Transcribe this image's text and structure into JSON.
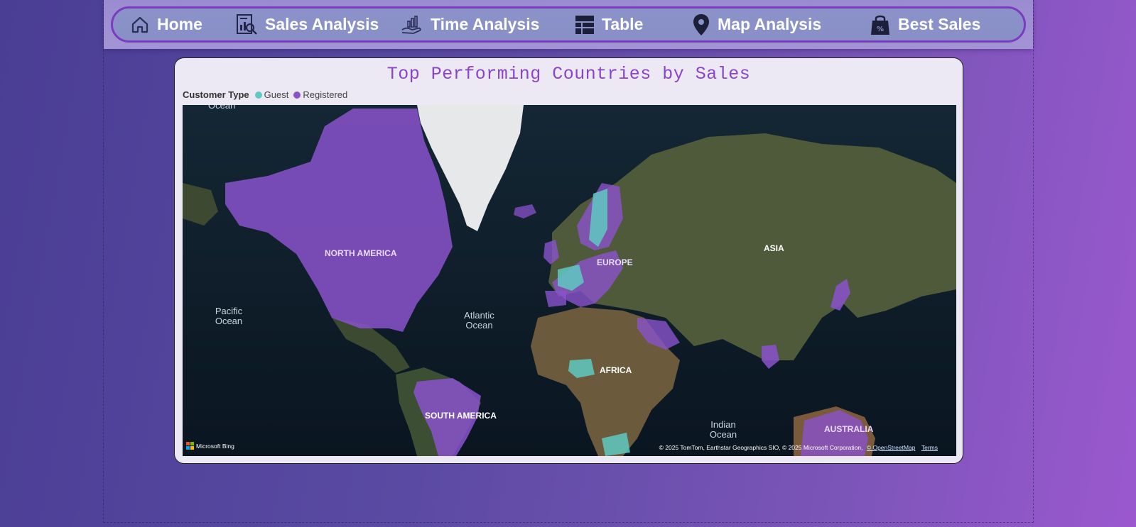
{
  "nav": {
    "items": [
      {
        "label": "Home",
        "icon": "home-icon"
      },
      {
        "label": "Sales Analysis",
        "icon": "sales-analysis-icon"
      },
      {
        "label": "Time Analysis",
        "icon": "hand-chart-icon"
      },
      {
        "label": "Table",
        "icon": "table-icon"
      },
      {
        "label": "Map Analysis",
        "icon": "map-pin-icon"
      },
      {
        "label": "Best Sales",
        "icon": "shopping-bag-percent-icon"
      }
    ]
  },
  "visual": {
    "title": "Top Performing Countries by Sales",
    "legend": {
      "title": "Customer Type",
      "entries": [
        {
          "label": "Guest",
          "color": "#5fc9c2"
        },
        {
          "label": "Registered",
          "color": "#8a52cc"
        }
      ]
    }
  },
  "map": {
    "labels": {
      "ocean_top": "Ocean",
      "north_america": "NORTH AMERICA",
      "south_america": "SOUTH AMERICA",
      "europe": "EUROPE",
      "asia": "ASIA",
      "africa": "AFRICA",
      "australia": "AUSTRALIA",
      "pacific": "Pacific Ocean",
      "atlantic": "Atlantic Ocean",
      "indian": "Indian Ocean"
    },
    "attribution": "© 2025 TomTom, Earthstar Geographics SIO, © 2025 Microsoft Corporation,",
    "attribution_osm": "© OpenStreetMap",
    "attribution_terms": "Terms",
    "provider": "Microsoft Bing"
  },
  "colors": {
    "guest": "#5fc9c2",
    "registered": "#8a52cc",
    "accent": "#8a45c8"
  }
}
